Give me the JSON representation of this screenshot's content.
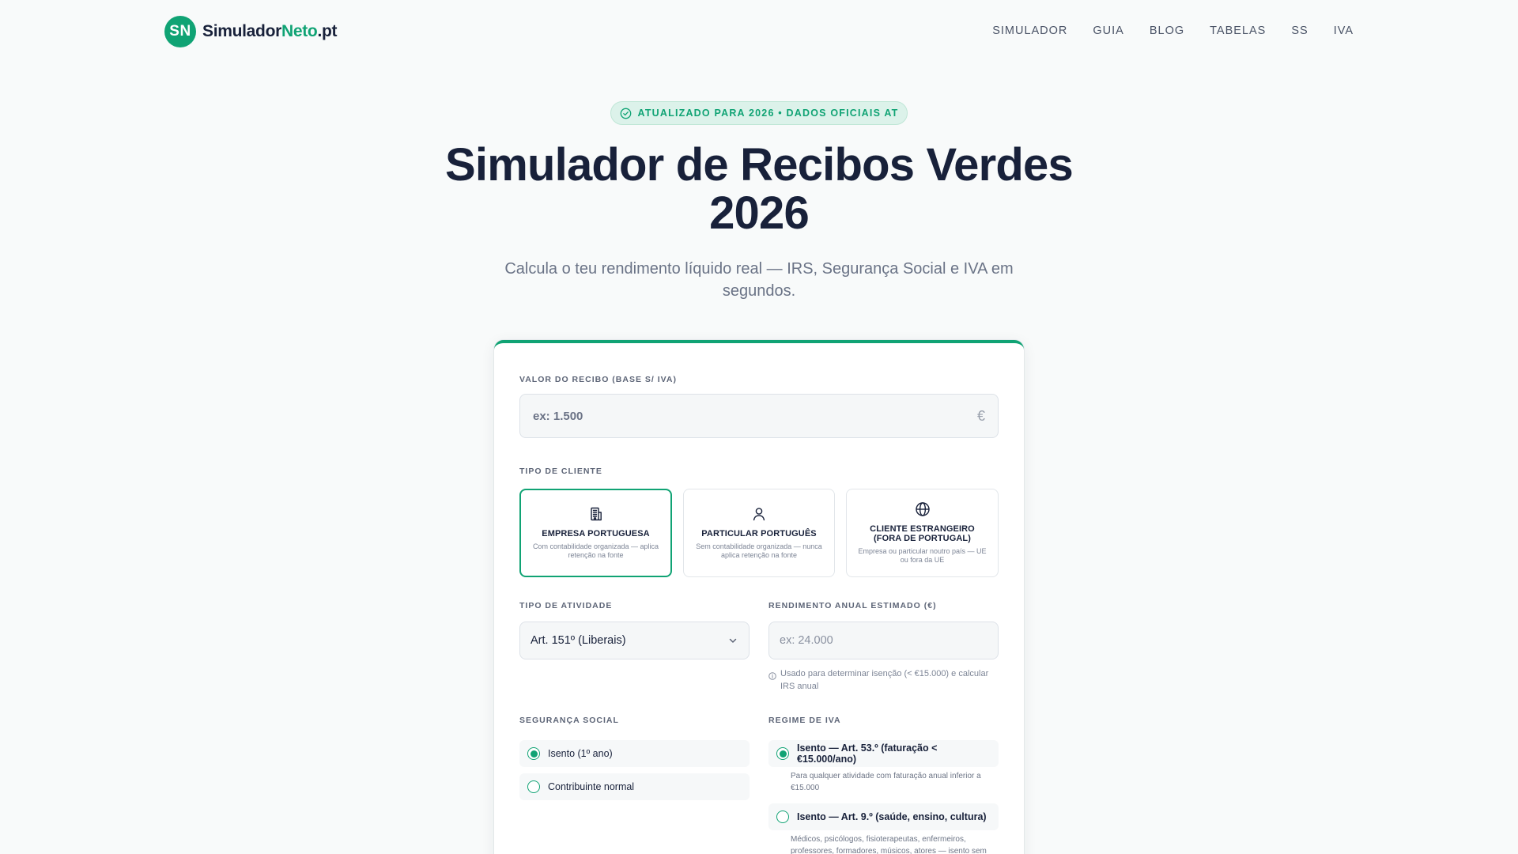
{
  "header": {
    "logo_badge": "SN",
    "logo_part1": "Simulador",
    "logo_part2": "Neto",
    "logo_part3": ".pt",
    "nav": [
      "SIMULADOR",
      "GUIA",
      "BLOG",
      "TABELAS",
      "SS",
      "IVA"
    ]
  },
  "hero": {
    "badge": "ATUALIZADO PARA 2026 • DADOS OFICIAIS AT",
    "title_line1": "Simulador de Recibos Verdes",
    "title_line2": "2026",
    "subtitle_line1": "Calcula o teu rendimento líquido real — IRS, Segurança Social e IVA em",
    "subtitle_line2": "segundos."
  },
  "form": {
    "value_label": "VALOR DO RECIBO (BASE S/ IVA)",
    "value_placeholder": "ex: 1.500",
    "currency": "€",
    "client_label": "TIPO DE CLIENTE",
    "clients": [
      {
        "title": "EMPRESA PORTUGUESA",
        "desc": "Com contabilidade organizada — aplica retenção na fonte",
        "icon": "building-icon"
      },
      {
        "title": "PARTICULAR PORTUGUÊS",
        "desc": "Sem contabilidade organizada — nunca aplica retenção na fonte",
        "icon": "user-icon"
      },
      {
        "title": "CLIENTE ESTRANGEIRO (FORA DE PORTUGAL)",
        "desc": "Empresa ou particular noutro país — UE ou fora da UE",
        "icon": "globe-icon"
      }
    ],
    "selected_client": "EMPRESA PORTUGUESA",
    "activity_label": "TIPO DE ATIVIDADE",
    "activity_value": "Art. 151º (Liberais)",
    "annual_label": "RENDIMENTO ANUAL ESTIMADO (€)",
    "annual_placeholder": "ex: 24.000",
    "annual_hint": "Usado para determinar isenção (< €15.000) e calcular IRS anual",
    "ss_label": "SEGURANÇA SOCIAL",
    "ss_options": [
      "Isento (1º ano)",
      "Contribuinte normal"
    ],
    "ss_selected": "Isento (1º ano)",
    "iva_label": "REGIME DE IVA",
    "iva_options": [
      {
        "label": "Isento — Art. 53.º (faturação < €15.000/ano)",
        "desc": "Para qualquer atividade com faturação anual inferior a €15.000"
      },
      {
        "label": "Isento — Art. 9.º (saúde, ensino, cultura)",
        "desc": "Médicos, psicólogos, fisioterapeutas, enfermeiros, professores, formadores, músicos, atores — isento sem"
      }
    ],
    "iva_selected": "Isento — Art. 53.º (faturação < €15.000/ano)"
  },
  "colors": {
    "accent": "#10a374",
    "title": "#18213a",
    "background": "#f8fafa"
  }
}
